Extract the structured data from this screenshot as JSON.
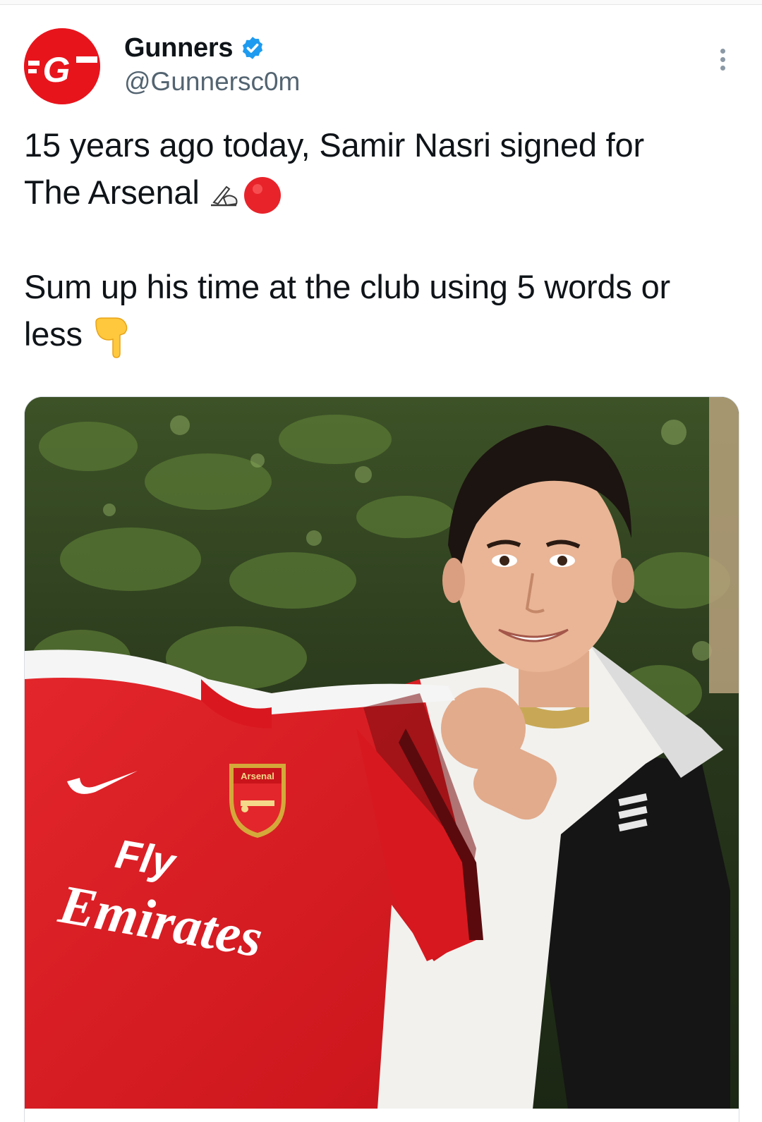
{
  "tweet": {
    "display_name": "Gunners",
    "handle": "@Gunnersc0m",
    "verified": true,
    "avatar_logo_text": "G",
    "text_line1": "15 years ago today, Samir Nasri signed for",
    "text_line2": "The Arsenal",
    "text_line3": "Sum up his time at the club using 5 words or",
    "text_line4": "less",
    "emojis": [
      "writing-hand-icon",
      "red-circle-icon",
      "pointing-down-icon"
    ]
  },
  "media": {
    "shirt_sponsor_line1": "Fly",
    "shirt_sponsor_line2": "Emirates",
    "crest_text": "Arsenal"
  },
  "colors": {
    "brand_red": "#e8141c",
    "verified_blue": "#1d9bf0",
    "handle_grey": "#536471",
    "text": "#0f1419"
  }
}
